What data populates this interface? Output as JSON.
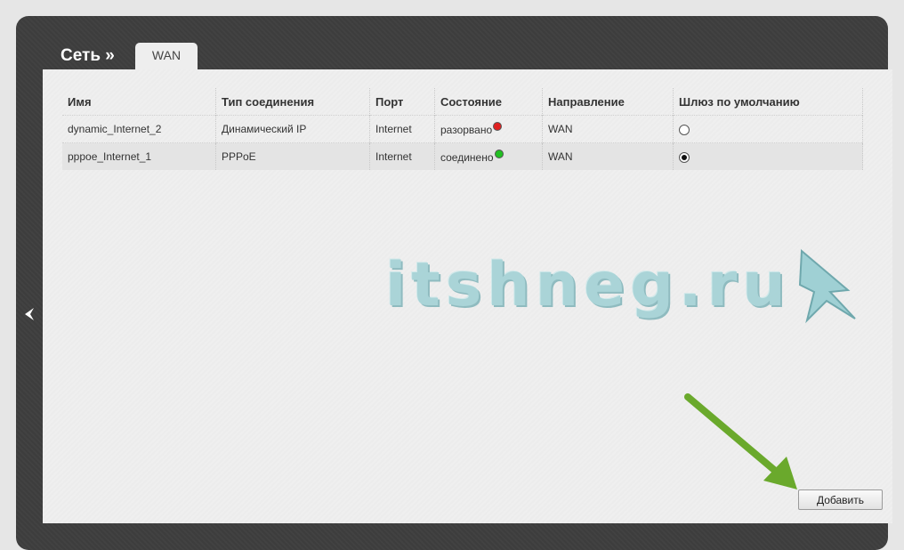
{
  "header": {
    "breadcrumb": "Сеть »",
    "tab_label": "WAN"
  },
  "table": {
    "columns": [
      "Имя",
      "Тип соединения",
      "Порт",
      "Состояние",
      "Направление",
      "Шлюз по умолчанию"
    ],
    "rows": [
      {
        "name": "dynamic_Internet_2",
        "type": "Динамический IP",
        "port": "Internet",
        "status": "разорвано",
        "status_color": "#e02020",
        "direction": "WAN",
        "default_gateway": false
      },
      {
        "name": "pppoe_Internet_1",
        "type": "PPPoE",
        "port": "Internet",
        "status": "соединено",
        "status_color": "#22c022",
        "direction": "WAN",
        "default_gateway": true
      }
    ]
  },
  "watermark": {
    "text": "itshneg.ru"
  },
  "actions": {
    "add_label": "Добавить"
  },
  "icons": {
    "collapse": "chevron-left-icon",
    "annotation": "green-arrow-icon"
  },
  "colors": {
    "annotation_arrow": "#6aa92c",
    "frame": "#3e3e3e",
    "panel": "#efefef"
  }
}
